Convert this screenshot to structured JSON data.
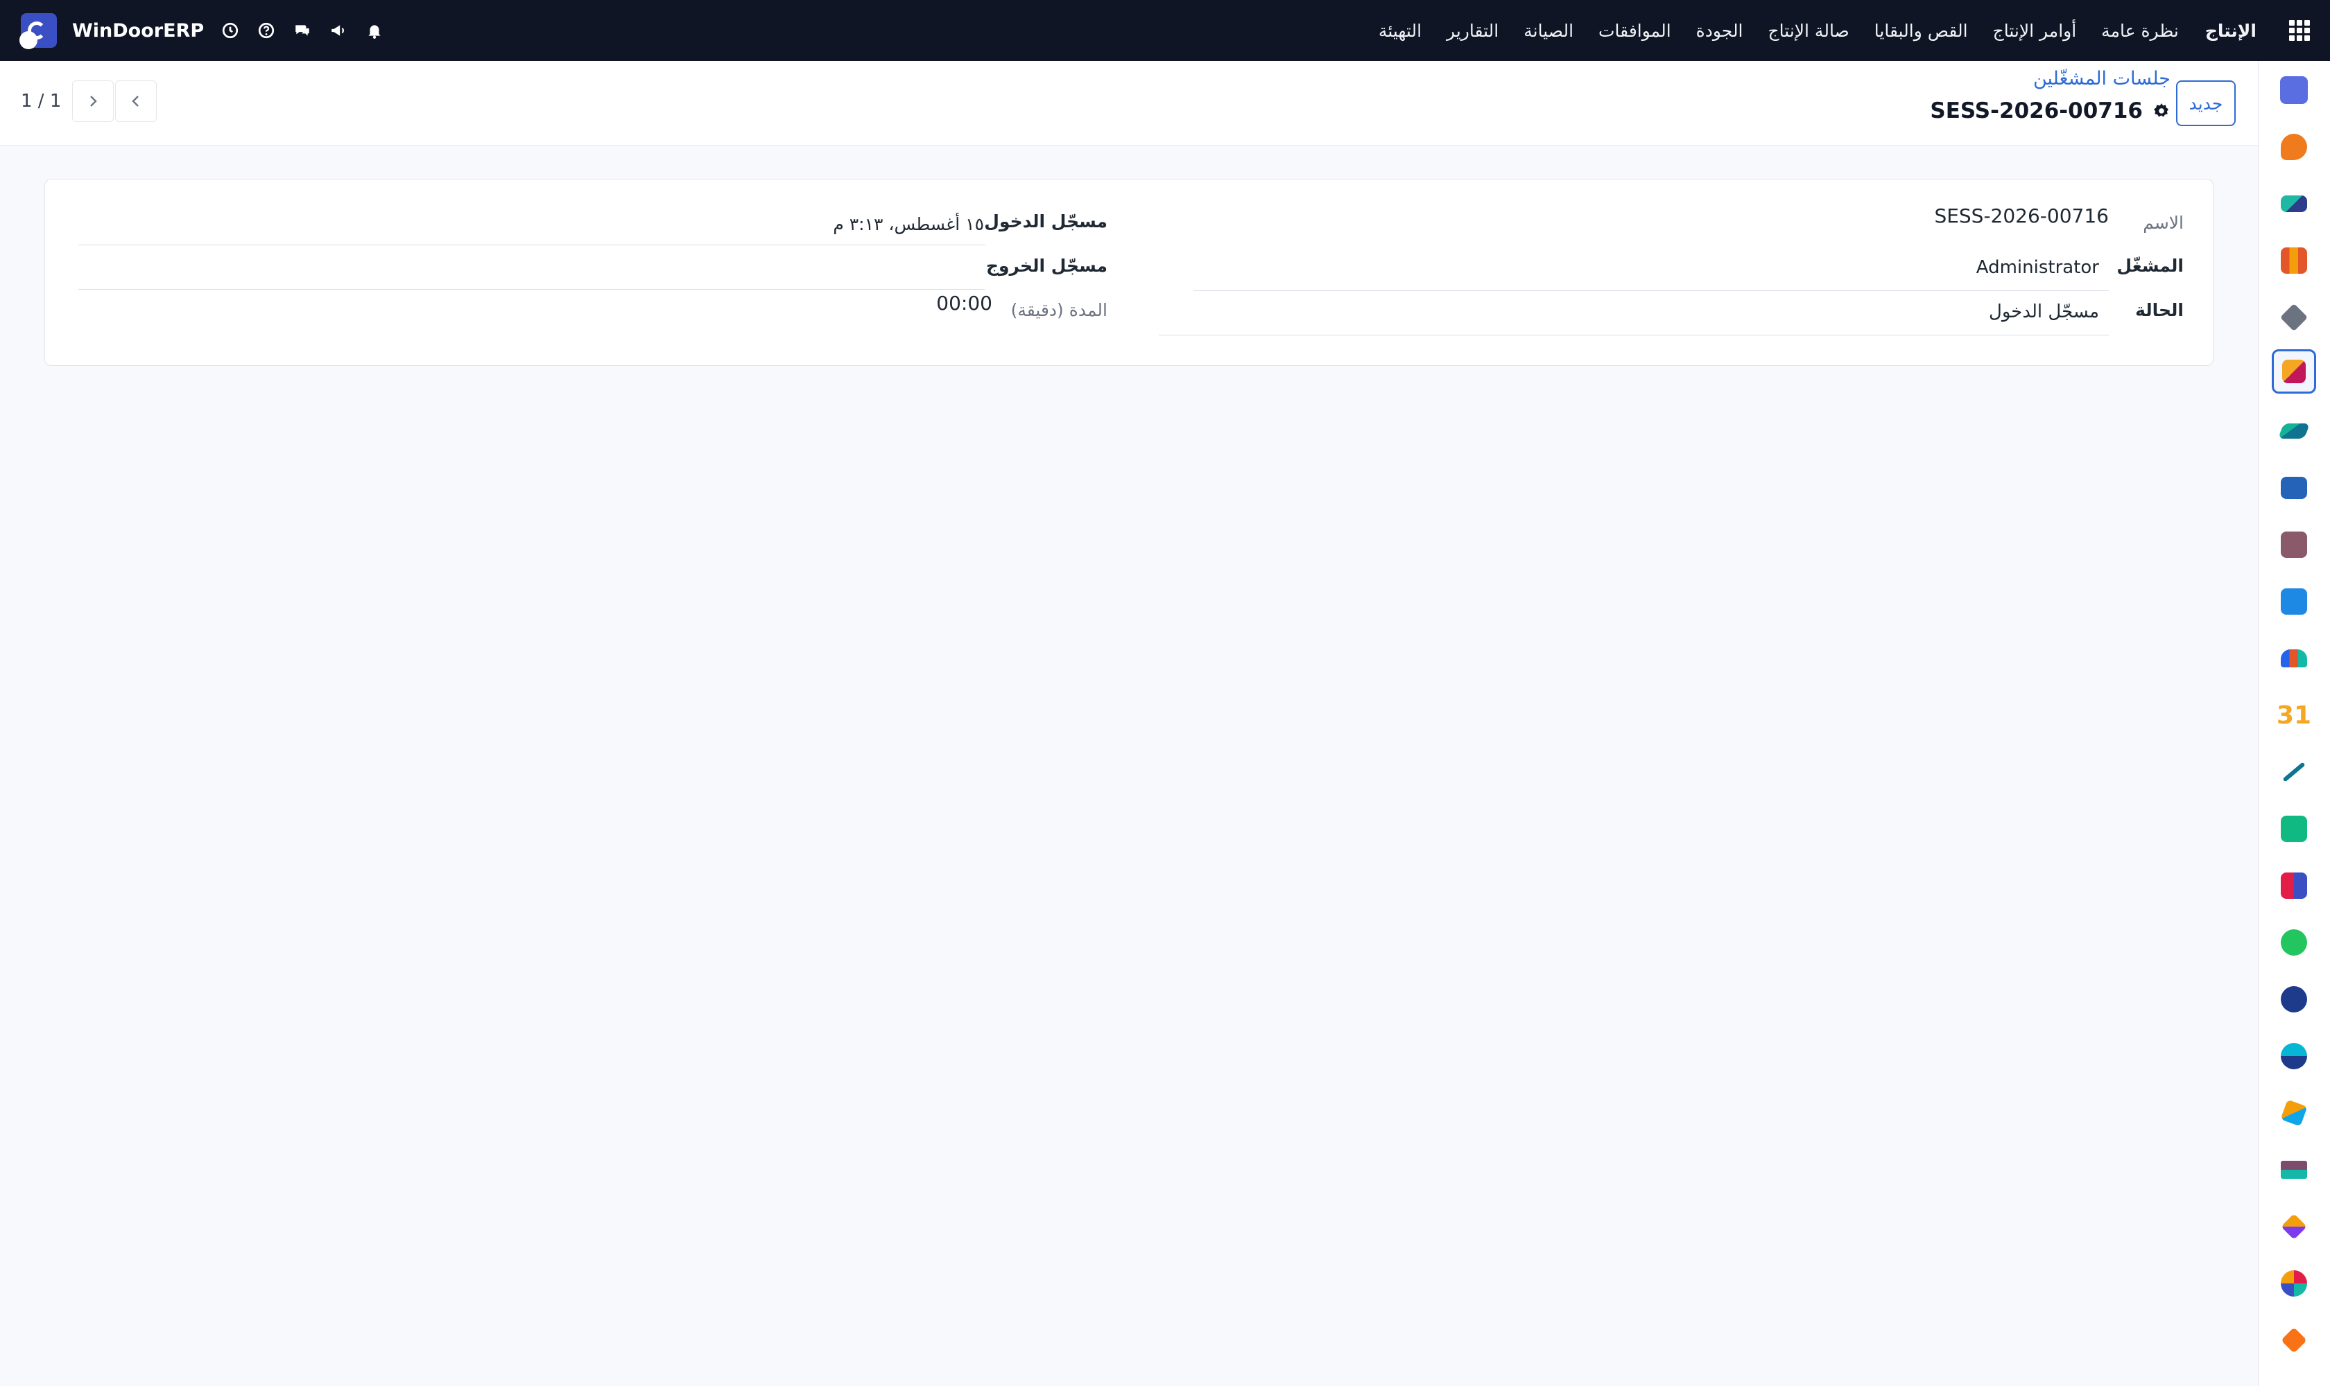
{
  "navbar": {
    "app_name": "الإنتاج",
    "menu": [
      "نظرة عامة",
      "أوامر الإنتاج",
      "القص والبقايا",
      "صالة الإنتاج",
      "الجودة",
      "الموافقات",
      "الصيانة",
      "التقارير",
      "التهيئة"
    ],
    "company": "WinDoorERP"
  },
  "control": {
    "new_button": "جديد",
    "breadcrumb": "جلسات المشغّلين",
    "record_name": "SESS-2026-00716",
    "pager_value": "1 / 1"
  },
  "form": {
    "name_label": "الاسم",
    "name_value": "SESS-2026-00716",
    "operator_label": "المشغّل",
    "operator_value": "Administrator",
    "state_label": "الحالة",
    "state_value": "مسجّل الدخول",
    "checkin_label": "مسجّل الدخول",
    "checkin_value": "١٥ أغسطس، ٣:١٣ م",
    "checkout_label": "مسجّل الخروج",
    "checkout_value": "",
    "duration_label": "المدة (دقيقة)",
    "duration_value": "00:00"
  },
  "sidebar_apps": [
    "m-app-icon",
    "chat-bubble-icon",
    "inventory-icon",
    "chart-bars-icon",
    "package-icon",
    "manufacturing-icon",
    "checkmark-icon",
    "book-icon",
    "box-icon",
    "invoice-icon",
    "team-icon",
    "calendar-31-icon",
    "pen-icon",
    "contact-icon",
    "dashboard-icon",
    "whatsapp-icon",
    "clock-icon",
    "wave-icon",
    "send-icon",
    "card-icon",
    "cube-icon",
    "pie-icon",
    "hexagon-icon"
  ],
  "colors": {
    "navbar": "#0f1524",
    "accent": "#2e6bd6",
    "background": "#f7f9fc"
  }
}
